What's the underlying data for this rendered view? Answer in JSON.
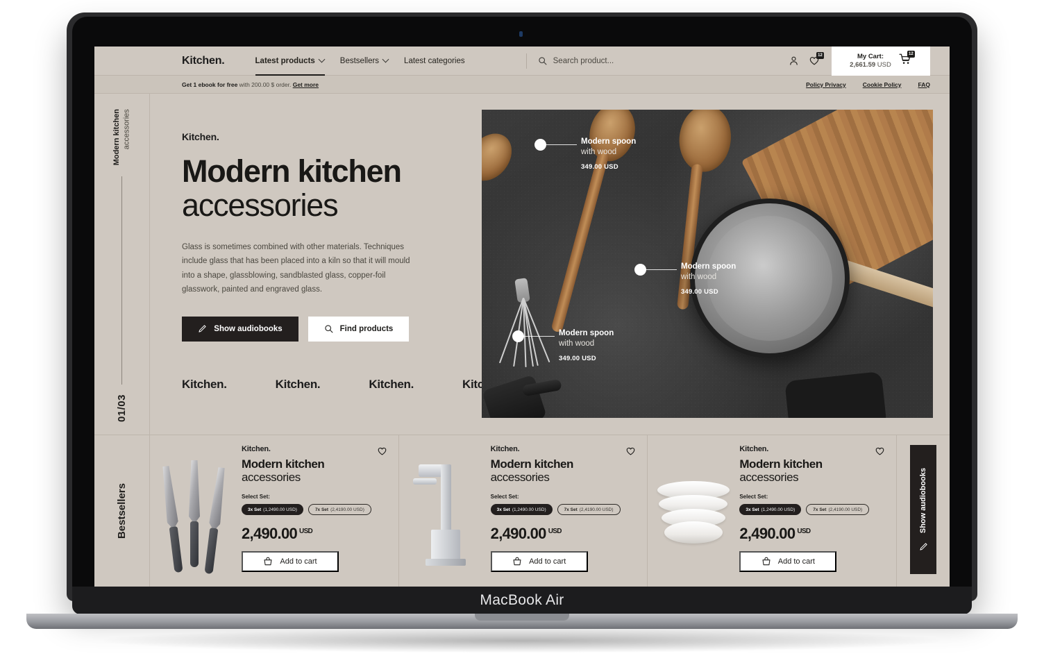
{
  "device": {
    "label": "MacBook Air"
  },
  "nav": {
    "brand": "Kitchen.",
    "links": [
      {
        "label": "Latest products",
        "caret": true,
        "active": true
      },
      {
        "label": "Bestsellers",
        "caret": true,
        "active": false
      },
      {
        "label": "Latest categories",
        "caret": false,
        "active": false
      }
    ],
    "search_placeholder": "Search product...",
    "account_icon": "user-icon",
    "wishlist_icon": "heart-icon",
    "wishlist_count": "12",
    "cart": {
      "title": "My Cart:",
      "amount": "2,661.59",
      "currency": "USD",
      "icon": "cart-icon",
      "count": "12"
    }
  },
  "promo": {
    "bold": "Get 1 ebook for free",
    "rest": " with 200.00 $ order. ",
    "link": "Get more",
    "links": [
      {
        "label": "Policy Privacy"
      },
      {
        "label": "Cookie Policy"
      },
      {
        "label": "FAQ"
      }
    ]
  },
  "hero": {
    "rail_title": "Modern kitchen",
    "rail_sub": "accessories",
    "slide_counter": "01/03",
    "kicker": "Kitchen.",
    "heading_bold": "Modern kitchen",
    "heading_light": "accessories",
    "paragraph": "Glass is sometimes combined with other materials. Techniques include glass that has been placed into a kiln so that it will mould into a shape, glassblowing, sandblasted glass, copper-foil glasswork, painted and engraved glass.",
    "primary_button": "Show audiobooks",
    "primary_icon": "pen-icon",
    "secondary_button": "Find products",
    "secondary_icon": "search-icon",
    "brand_marks": [
      "Kitchen.",
      "Kitchen.",
      "Kitchen.",
      "Kitchen."
    ],
    "annotations": [
      {
        "title": "Modern spoon",
        "subtitle": "with wood",
        "price": "349.00 USD"
      },
      {
        "title": "Modern spoon",
        "subtitle": "with wood",
        "price": "349.00 USD"
      },
      {
        "title": "Modern spoon",
        "subtitle": "with wood",
        "price": "349.00 USD"
      }
    ]
  },
  "bestsellers": {
    "rail_label": "Bestsellers",
    "side_tab": {
      "label": "Show audiobooks",
      "icon": "pen-icon"
    },
    "select_label": "Select Set:",
    "cart_button": "Add to cart",
    "cards": [
      {
        "brand": "Kitchen.",
        "title": "Modern kitchen",
        "subtitle": "accessories",
        "product_icon": "knives-illustration",
        "wishlist_icon": "heart-icon",
        "chips": [
          {
            "name": "3x Set",
            "price": "(1,2490.00 USD)",
            "selected": true
          },
          {
            "name": "7x Set",
            "price": "(2,4190.00 USD)",
            "selected": false
          }
        ],
        "price": "2,490.00",
        "currency": "USD"
      },
      {
        "brand": "Kitchen.",
        "title": "Modern kitchen",
        "subtitle": "accessories",
        "product_icon": "faucet-illustration",
        "wishlist_icon": "heart-icon",
        "chips": [
          {
            "name": "3x Set",
            "price": "(1,2490.00 USD)",
            "selected": true
          },
          {
            "name": "7x Set",
            "price": "(2,4190.00 USD)",
            "selected": false
          }
        ],
        "price": "2,490.00",
        "currency": "USD"
      },
      {
        "brand": "Kitchen.",
        "title": "Modern kitchen",
        "subtitle": "accessories",
        "product_icon": "bowls-illustration",
        "wishlist_icon": "heart-icon",
        "chips": [
          {
            "name": "3x Set",
            "price": "(1,2490.00 USD)",
            "selected": true
          },
          {
            "name": "7x Set",
            "price": "(2,4190.00 USD)",
            "selected": false
          }
        ],
        "price": "2,490.00",
        "currency": "USD"
      }
    ]
  },
  "colors": {
    "page_bg": "#cfc8c0",
    "ink": "#191816",
    "card_white": "#ffffff",
    "dark_button": "#231f1e"
  }
}
